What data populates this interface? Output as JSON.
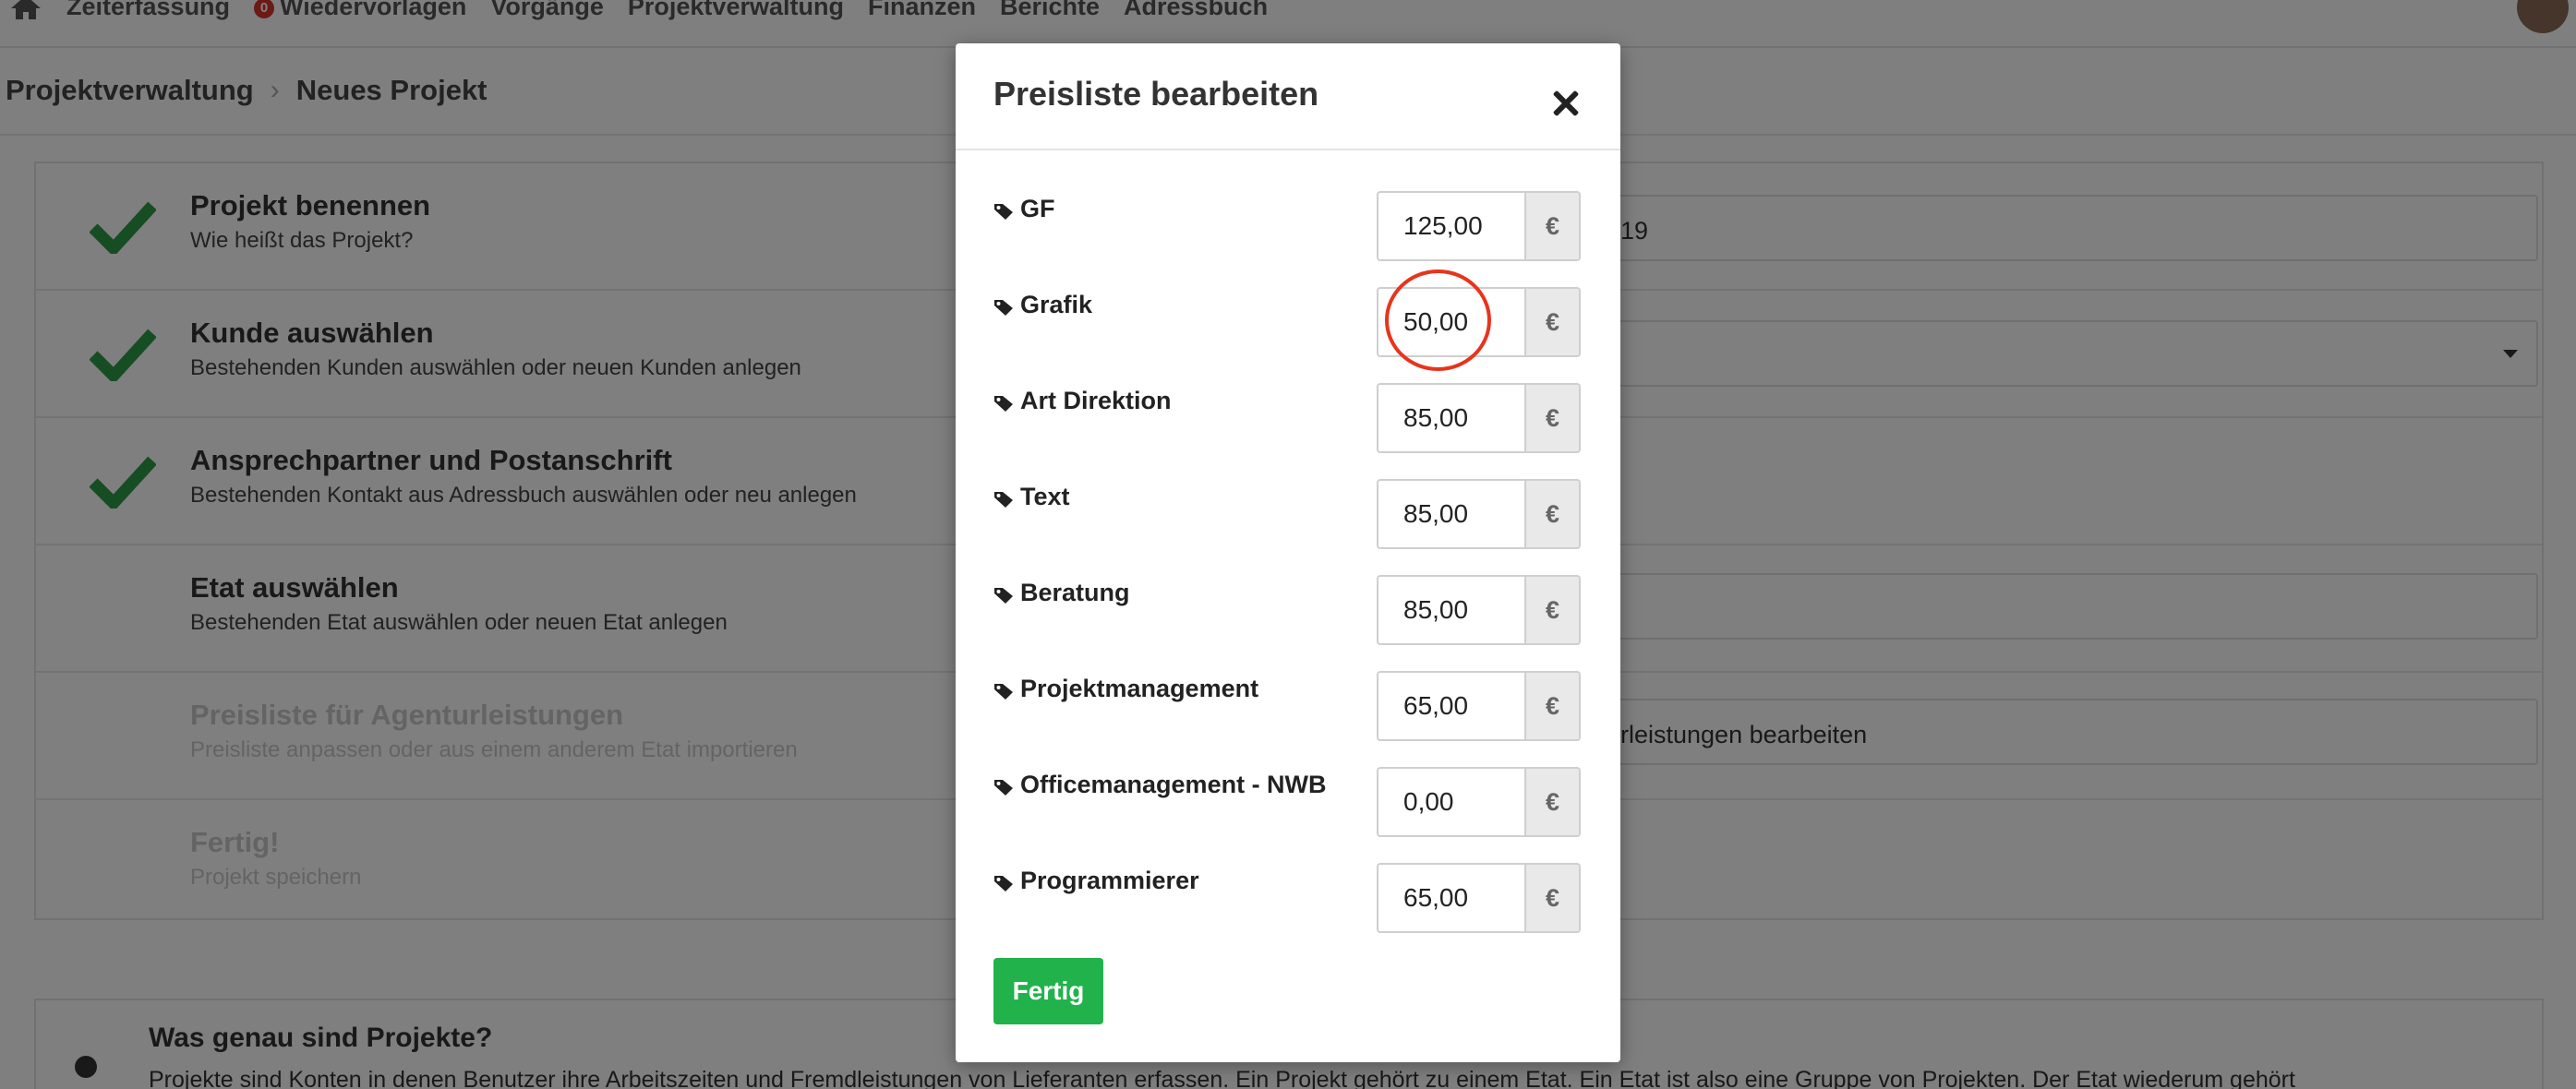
{
  "nav": {
    "items": [
      "Zeiterfassung",
      "Wiedervorlagen",
      "Vorgänge",
      "Projektverwaltung",
      "Finanzen",
      "Berichte",
      "Adressbuch"
    ],
    "badge": "0"
  },
  "breadcrumb": {
    "parent": "Projektverwaltung",
    "current": "Neues Projekt"
  },
  "steps": [
    {
      "title": "Projekt benennen",
      "subtitle": "Wie heißt das Projekt?",
      "done": true
    },
    {
      "title": "Kunde auswählen",
      "subtitle": "Bestehenden Kunden auswählen oder neuen Kunden anlegen",
      "done": true
    },
    {
      "title": "Ansprechpartner und Postanschrift",
      "subtitle": "Bestehenden Kontakt aus Adressbuch auswählen oder neu anlegen",
      "done": true
    },
    {
      "title": "Etat auswählen",
      "subtitle": "Bestehenden Etat auswählen oder neuen Etat anlegen",
      "done": false
    },
    {
      "title": "Preisliste für Agenturleistungen",
      "subtitle": "Preisliste anpassen oder aus einem anderem Etat importieren",
      "done": false
    },
    {
      "title": "Fertig!",
      "subtitle": "Projekt speichern",
      "done": false
    }
  ],
  "right_fields": {
    "project_name_tail": "19",
    "pricelist_link": "rleistungen bearbeiten"
  },
  "info": {
    "title": "Was genau sind Projekte?",
    "text": "Projekte sind Konten in denen Benutzer ihre Arbeitszeiten und Fremdleistungen von Lieferanten erfassen. Ein Projekt gehört zu einem Etat. Ein Etat ist also eine Gruppe von Projekten. Der Etat wiederum gehört"
  },
  "modal": {
    "title": "Preisliste bearbeiten",
    "currency": "€",
    "done_label": "Fertig",
    "items": [
      {
        "label": "GF",
        "value": "125,00"
      },
      {
        "label": "Grafik",
        "value": "50,00"
      },
      {
        "label": "Art Direktion",
        "value": "85,00"
      },
      {
        "label": "Text",
        "value": "85,00"
      },
      {
        "label": "Beratung",
        "value": "85,00"
      },
      {
        "label": "Projektmanagement",
        "value": "65,00"
      },
      {
        "label": "Officemanagement - NWB",
        "value": "0,00"
      },
      {
        "label": "Programmierer",
        "value": "65,00"
      }
    ]
  },
  "colors": {
    "check": "#2e9a45",
    "done_button": "#22b24c",
    "highlight": "#e8341c"
  }
}
